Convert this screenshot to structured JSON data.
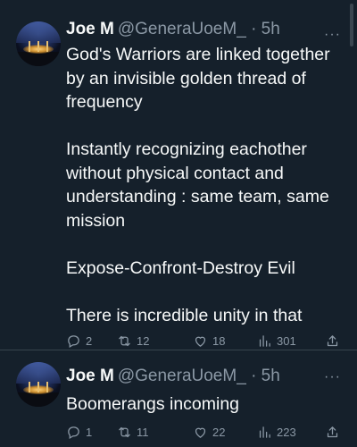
{
  "tweets": [
    {
      "name": "Joe M",
      "handle": "@GeneraUoeM_",
      "time": "· 5h",
      "more": "···",
      "paragraphs": [
        "God's Warriors are linked together by an invisible golden thread of frequency",
        "Instantly recognizing eachother without physical contact and understanding : same team, same mission",
        "Expose-Confront-Destroy Evil",
        "There is incredible unity in that"
      ],
      "replies": "2",
      "retweets": "12",
      "likes": "18",
      "views": "301"
    },
    {
      "name": "Joe M",
      "handle": "@GeneraUoeM_",
      "time": "· 5h",
      "more": "···",
      "paragraphs": [
        "Boomerangs incoming"
      ],
      "replies": "1",
      "retweets": "11",
      "likes": "22",
      "views": "223"
    }
  ],
  "icons": {
    "reply": "reply-icon",
    "retweet": "retweet-icon",
    "like": "heart-icon",
    "views": "views-icon",
    "share": "share-icon"
  },
  "colors": {
    "background": "#15202b",
    "text": "#f7f9f9",
    "secondary": "#8b98a5",
    "divider": "#38444d"
  }
}
